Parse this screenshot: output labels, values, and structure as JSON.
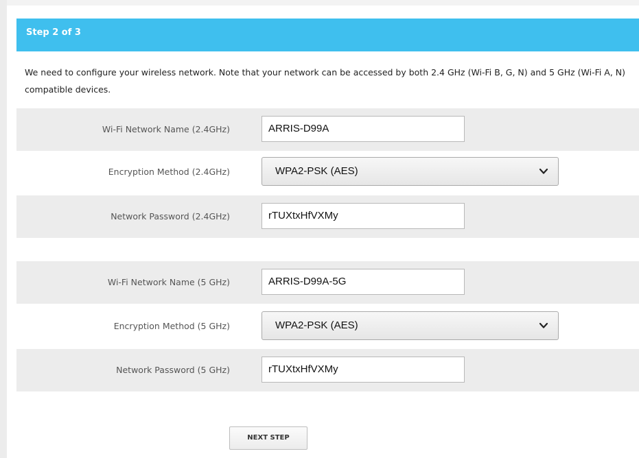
{
  "header": {
    "step_label": "Step 2 of 3"
  },
  "intro": {
    "text": "We need to configure your wireless network. Note that your network can be accessed by both 2.4 GHz (Wi-Fi B, G, N) and 5 GHz (Wi-Fi A, N) compatible devices."
  },
  "band_24": {
    "ssid_label": "Wi-Fi Network Name (2.4GHz)",
    "ssid_value": "ARRIS-D99A",
    "encryption_label": "Encryption Method (2.4GHz)",
    "encryption_value": "WPA2-PSK (AES)",
    "password_label": "Network Password (2.4GHz)",
    "password_value": "rTUXtxHfVXMy"
  },
  "band_5": {
    "ssid_label": "Wi-Fi Network Name (5 GHz)",
    "ssid_value": "ARRIS-D99A-5G",
    "encryption_label": "Encryption Method (5 GHz)",
    "encryption_value": "WPA2-PSK (AES)",
    "password_label": "Network Password (5 GHz)",
    "password_value": "rTUXtxHfVXMy"
  },
  "actions": {
    "next_label": "NEXT STEP"
  },
  "colors": {
    "header_bg": "#3fbfee",
    "row_shade": "#ececec"
  },
  "icons": {
    "select_chevron": "chevron-down-icon"
  }
}
